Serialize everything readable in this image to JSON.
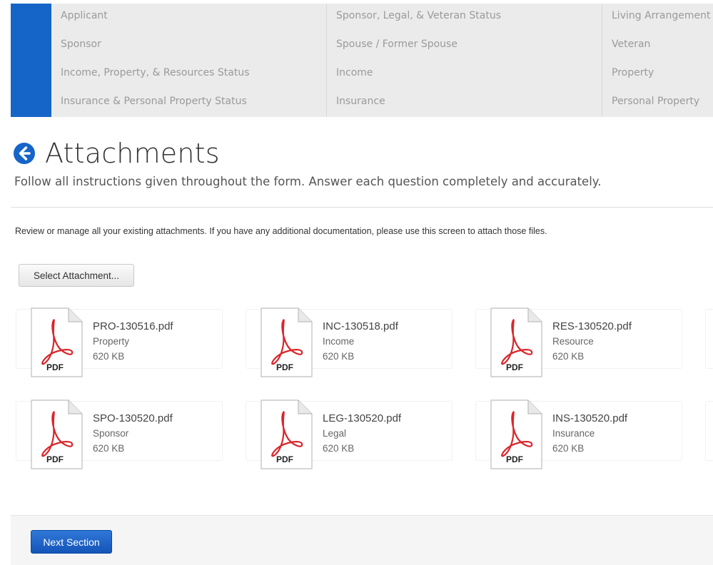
{
  "topnav": {
    "col1": [
      "Applicant",
      "Sponsor",
      "Income, Property, & Resources Status",
      "Insurance & Personal Property Status"
    ],
    "col2": [
      "Sponsor, Legal, & Veteran Status",
      "Spouse / Former Spouse",
      "Income",
      "Insurance"
    ],
    "col3": [
      "Living Arrangement",
      "Veteran",
      "Property",
      "Personal Property"
    ],
    "accent_color": "#1565c8"
  },
  "page": {
    "title": "Attachments",
    "subtitle": "Follow all instructions given throughout the form. Answer each question completely and accurately.",
    "instructions": "Review or manage all your existing attachments. If you have any additional documentation, please use this screen to attach those files."
  },
  "buttons": {
    "select_attachment": "Select Attachment...",
    "next_section": "Next Section"
  },
  "pdf_badge": "PDF",
  "attachments": [
    {
      "name": "PRO-130516.pdf",
      "category": "Property",
      "size": "620 KB"
    },
    {
      "name": "INC-130518.pdf",
      "category": "Income",
      "size": "620 KB"
    },
    {
      "name": "RES-130520.pdf",
      "category": "Resource",
      "size": "620 KB"
    },
    {
      "name": "SPO-130520.pdf",
      "category": "Sponsor",
      "size": "620 KB"
    },
    {
      "name": "LEG-130520.pdf",
      "category": "Legal",
      "size": "620 KB"
    },
    {
      "name": "INS-130520.pdf",
      "category": "Insurance",
      "size": "620 KB"
    }
  ],
  "icons": {
    "back": "arrow-left-circle-icon",
    "file": "pdf-file-icon"
  }
}
